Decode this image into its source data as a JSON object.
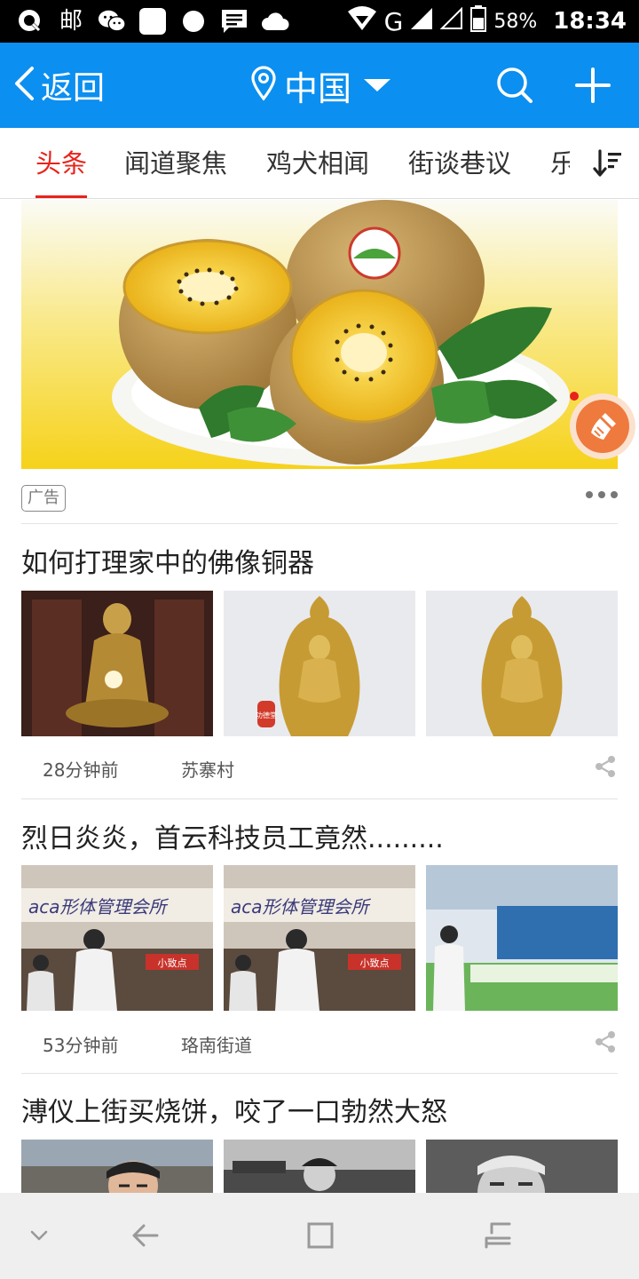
{
  "status_bar": {
    "left_icons": [
      "q-app-icon",
      "post-icon",
      "wechat-icon",
      "app-square-icon",
      "record-dot-icon",
      "message-icon",
      "cloud-icon"
    ],
    "post_glyph": "邮",
    "network": "G",
    "battery": "58%",
    "time": "18:34"
  },
  "appbar": {
    "back_label": "返回",
    "location": "中国",
    "color": "#0b8ff0"
  },
  "tabs": [
    {
      "label": "头条",
      "active": true
    },
    {
      "label": "闻道聚焦",
      "active": false
    },
    {
      "label": "鸡犬相闻",
      "active": false
    },
    {
      "label": "街谈巷议",
      "active": false
    },
    {
      "label": "乐",
      "active": false
    }
  ],
  "ad": {
    "tag": "广告"
  },
  "articles": [
    {
      "title": "如何打理家中的佛像铜器",
      "time": "28分钟前",
      "source": "苏寨村"
    },
    {
      "title": "烈日炎炎，首云科技员工竟然.........",
      "time": "53分钟前",
      "source": "珞南街道"
    },
    {
      "title": "溥仪上街买烧饼，咬了一口勃然大怒",
      "time": "",
      "source": ""
    }
  ],
  "thumb_text": {
    "sign_text": "aca形体管理会所",
    "shop_text": "小致点",
    "seal_text": "功德堂"
  },
  "colors": {
    "accent_red": "#e8231b",
    "appbar_blue": "#0b8ff0",
    "clean_button": "#ef7a3d"
  }
}
